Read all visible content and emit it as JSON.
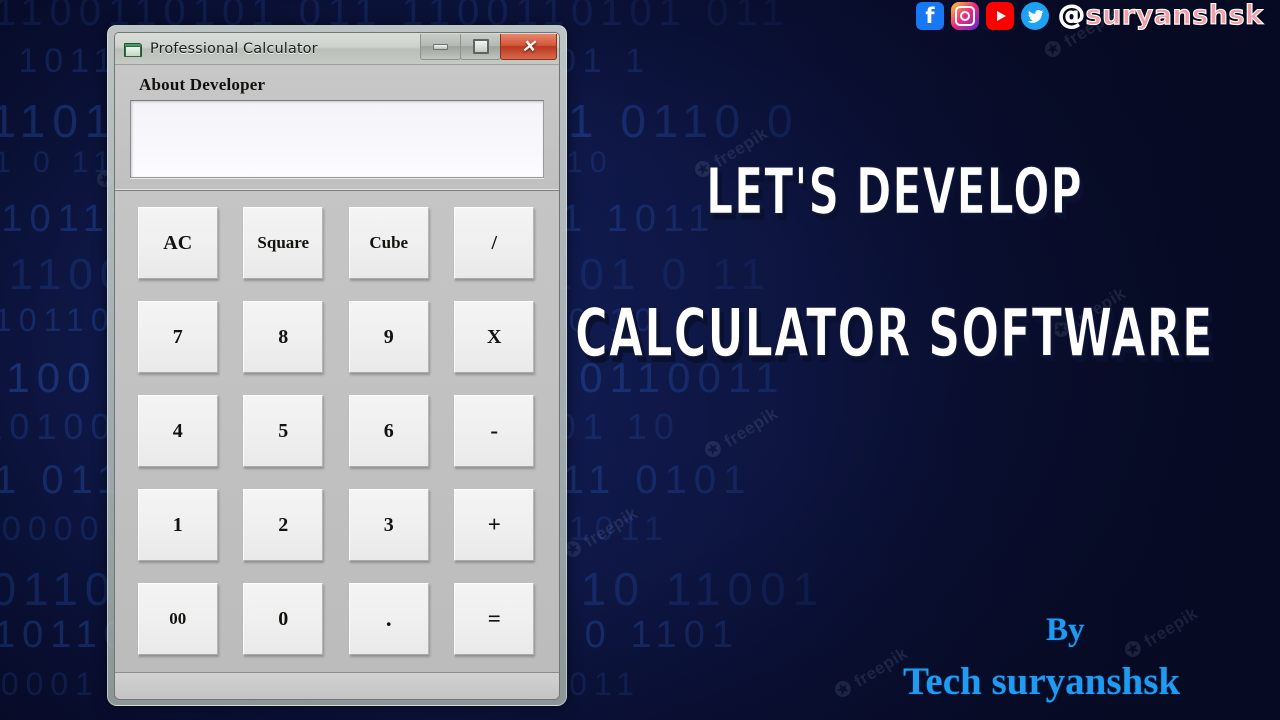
{
  "background": {
    "base_color": "#101a4d",
    "binary_rows": [
      "1100110101 011",
      "0 1011 01101 1",
      "01101 1 0110 0",
      "1 0 1101011 10",
      "110111 01 1011",
      "0 1100101 0 11",
      "1011001 110 10",
      "0100 1 0110011",
      "11010011 01 10",
      "1 0110 11 0101",
      "100000 0 11011",
      "10110 10 11001",
      "1011011 0 1101",
      "00001 110 1011"
    ],
    "watermark_text": "freepik",
    "watermark_count": 9
  },
  "window": {
    "title": "Professional Calculator",
    "icon": "folder-icon",
    "controls": {
      "minimize": "–",
      "maximize": "□",
      "close": "✕"
    }
  },
  "display": {
    "label": "About Developer",
    "value": "",
    "placeholder": ""
  },
  "keypad": {
    "rows": [
      [
        {
          "label": "AC",
          "name": "key-all-clear",
          "style": "normal"
        },
        {
          "label": "Square",
          "name": "key-square",
          "style": "small"
        },
        {
          "label": "Cube",
          "name": "key-cube",
          "style": "small"
        },
        {
          "label": "/",
          "name": "key-divide",
          "style": "normal"
        }
      ],
      [
        {
          "label": "7",
          "name": "key-7",
          "style": "normal"
        },
        {
          "label": "8",
          "name": "key-8",
          "style": "normal"
        },
        {
          "label": "9",
          "name": "key-9",
          "style": "normal"
        },
        {
          "label": "X",
          "name": "key-multiply",
          "style": "normal"
        }
      ],
      [
        {
          "label": "4",
          "name": "key-4",
          "style": "normal"
        },
        {
          "label": "5",
          "name": "key-5",
          "style": "normal"
        },
        {
          "label": "6",
          "name": "key-6",
          "style": "normal"
        },
        {
          "label": "-",
          "name": "key-subtract",
          "style": "glyph"
        }
      ],
      [
        {
          "label": "1",
          "name": "key-1",
          "style": "normal"
        },
        {
          "label": "2",
          "name": "key-2",
          "style": "normal"
        },
        {
          "label": "3",
          "name": "key-3",
          "style": "normal"
        },
        {
          "label": "+",
          "name": "key-add",
          "style": "glyph"
        }
      ],
      [
        {
          "label": "00",
          "name": "key-double-zero",
          "style": "small"
        },
        {
          "label": "0",
          "name": "key-0",
          "style": "normal"
        },
        {
          "label": ".",
          "name": "key-decimal",
          "style": "glyph"
        },
        {
          "label": "=",
          "name": "key-equals",
          "style": "glyph"
        }
      ]
    ]
  },
  "overlay": {
    "headline_line1": "LET'S DEVELOP",
    "headline_line2": "CALCULATOR SOFTWARE",
    "headline_color": "#ffffff",
    "by_word": "By",
    "by_name": "Tech suryanshsk",
    "by_color": "#1f9cf0",
    "handle_at": "@",
    "handle_name": "suryanshsk",
    "handle_color": "#f2a0a8",
    "social": [
      {
        "name": "facebook-icon",
        "label": "f"
      },
      {
        "name": "instagram-icon",
        "label": ""
      },
      {
        "name": "youtube-icon",
        "label": ""
      },
      {
        "name": "twitter-icon",
        "label": ""
      }
    ]
  }
}
